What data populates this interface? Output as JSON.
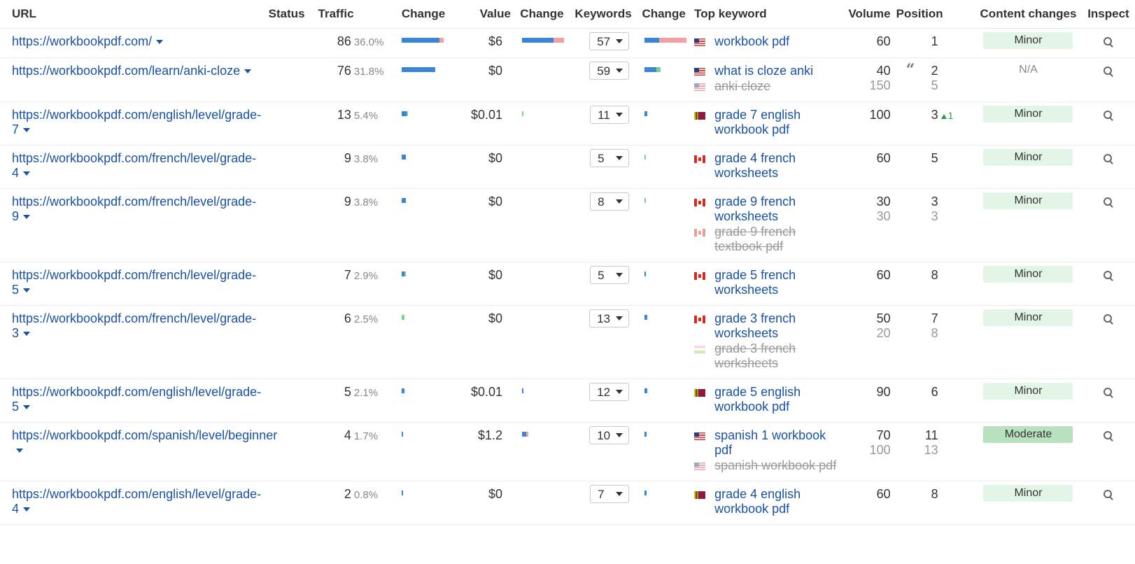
{
  "headers": {
    "url": "URL",
    "status": "Status",
    "traffic": "Traffic",
    "traffic_change": "Change",
    "value": "Value",
    "value_change": "Change",
    "keywords": "Keywords",
    "keywords_change": "Change",
    "top_keyword": "Top keyword",
    "volume": "Volume",
    "position": "Position",
    "content_changes": "Content changes",
    "inspect": "Inspect"
  },
  "colors": {
    "link": "#1a52a5",
    "bar_blue": "#3a85d6",
    "bar_pink": "#f2a0a0",
    "bar_green": "#7ccf8f",
    "badge_minor": "#e2f5e6",
    "badge_moderate": "#b8e2bf",
    "position_up": "#2c9b43"
  },
  "rows": [
    {
      "url": "https://workbookpdf.com/",
      "traffic": "86",
      "traffic_pct": "36.0%",
      "traffic_bar": [
        {
          "c": "blue",
          "f": 0.9
        },
        {
          "c": "pink",
          "f": 0.1
        }
      ],
      "value": "$6",
      "value_bar": [
        {
          "c": "blue",
          "f": 0.75
        },
        {
          "c": "pink",
          "f": 0.25
        }
      ],
      "keywords": "57",
      "kw_bar": [
        {
          "c": "blue",
          "f": 0.35
        },
        {
          "c": "pink",
          "f": 0.65
        }
      ],
      "keywords_list": [
        {
          "flag": "us",
          "text": "workbook pdf",
          "muted": false
        }
      ],
      "volumes": [
        "60"
      ],
      "positions": [
        "1"
      ],
      "pos_up": "",
      "quote": false,
      "content_change": "Minor",
      "badge": "minor"
    },
    {
      "url": "https://workbookpdf.com/learn/anki-cloze",
      "traffic": "76",
      "traffic_pct": "31.8%",
      "traffic_bar": [
        {
          "c": "blue",
          "f": 0.8
        }
      ],
      "value": "$0",
      "value_bar": [],
      "keywords": "59",
      "kw_bar": [
        {
          "c": "blue",
          "f": 0.28
        },
        {
          "c": "green",
          "f": 0.1
        }
      ],
      "keywords_list": [
        {
          "flag": "us",
          "text": "what is cloze anki",
          "muted": false
        },
        {
          "flag": "us",
          "text": "anki cloze",
          "muted": true
        }
      ],
      "volumes": [
        "40",
        "150"
      ],
      "positions": [
        "2",
        "5"
      ],
      "pos_up": "",
      "quote": true,
      "content_change": "N/A",
      "badge": "na"
    },
    {
      "url": "https://workbookpdf.com/english/level/grade-7",
      "traffic": "13",
      "traffic_pct": "5.4%",
      "traffic_bar": [
        {
          "c": "blue",
          "f": 0.12
        },
        {
          "c": "green",
          "f": 0.03
        }
      ],
      "value": "$0.01",
      "value_bar": [
        {
          "c": "green",
          "f": 0.02
        }
      ],
      "keywords": "11",
      "kw_bar": [
        {
          "c": "blue",
          "f": 0.06
        }
      ],
      "keywords_list": [
        {
          "flag": "lk",
          "text": "grade 7 english workbook pdf",
          "muted": false
        }
      ],
      "volumes": [
        "100"
      ],
      "positions": [
        "3"
      ],
      "pos_up": "1",
      "quote": false,
      "content_change": "Minor",
      "badge": "minor"
    },
    {
      "url": "https://workbookpdf.com/french/level/grade-4",
      "traffic": "9",
      "traffic_pct": "3.8%",
      "traffic_bar": [
        {
          "c": "blue",
          "f": 0.1
        }
      ],
      "value": "$0",
      "value_bar": [],
      "keywords": "5",
      "kw_bar": [
        {
          "c": "green",
          "f": 0.04
        }
      ],
      "keywords_list": [
        {
          "flag": "ca",
          "text": "grade 4 french worksheets",
          "muted": false
        }
      ],
      "volumes": [
        "60"
      ],
      "positions": [
        "5"
      ],
      "pos_up": "",
      "quote": false,
      "content_change": "Minor",
      "badge": "minor"
    },
    {
      "url": "https://workbookpdf.com/french/level/grade-9",
      "traffic": "9",
      "traffic_pct": "3.8%",
      "traffic_bar": [
        {
          "c": "blue",
          "f": 0.1
        }
      ],
      "value": "$0",
      "value_bar": [],
      "keywords": "8",
      "kw_bar": [
        {
          "c": "green",
          "f": 0.04
        }
      ],
      "keywords_list": [
        {
          "flag": "ca",
          "text": "grade 9 french worksheets",
          "muted": false
        },
        {
          "flag": "ca",
          "text": "grade 9 french textbook pdf",
          "muted": true
        }
      ],
      "volumes": [
        "30",
        "30"
      ],
      "positions": [
        "3",
        "3"
      ],
      "pos_up": "",
      "quote": false,
      "content_change": "Minor",
      "badge": "minor"
    },
    {
      "url": "https://workbookpdf.com/french/level/grade-5",
      "traffic": "7",
      "traffic_pct": "2.9%",
      "traffic_bar": [
        {
          "c": "blue",
          "f": 0.06
        },
        {
          "c": "green",
          "f": 0.02
        }
      ],
      "value": "$0",
      "value_bar": [],
      "keywords": "5",
      "kw_bar": [
        {
          "c": "blue",
          "f": 0.03
        }
      ],
      "keywords_list": [
        {
          "flag": "ca",
          "text": "grade 5 french worksheets",
          "muted": false
        }
      ],
      "volumes": [
        "60"
      ],
      "positions": [
        "8"
      ],
      "pos_up": "",
      "quote": false,
      "content_change": "Minor",
      "badge": "minor"
    },
    {
      "url": "https://workbookpdf.com/french/level/grade-3",
      "traffic": "6",
      "traffic_pct": "2.5%",
      "traffic_bar": [
        {
          "c": "green",
          "f": 0.06
        }
      ],
      "value": "$0",
      "value_bar": [],
      "keywords": "13",
      "kw_bar": [
        {
          "c": "blue",
          "f": 0.07
        }
      ],
      "keywords_list": [
        {
          "flag": "ca",
          "text": "grade 3 french worksheets",
          "muted": false
        },
        {
          "flag": "tri",
          "text": "grade 3 french worksheets",
          "muted": true
        }
      ],
      "volumes": [
        "50",
        "20"
      ],
      "positions": [
        "7",
        "8"
      ],
      "pos_up": "",
      "quote": false,
      "content_change": "Minor",
      "badge": "minor"
    },
    {
      "url": "https://workbookpdf.com/english/level/grade-5",
      "traffic": "5",
      "traffic_pct": "2.1%",
      "traffic_bar": [
        {
          "c": "blue",
          "f": 0.06
        }
      ],
      "value": "$0.01",
      "value_bar": [
        {
          "c": "blue",
          "f": 0.02
        }
      ],
      "keywords": "12",
      "kw_bar": [
        {
          "c": "blue",
          "f": 0.06
        }
      ],
      "keywords_list": [
        {
          "flag": "lk",
          "text": "grade 5 english workbook pdf",
          "muted": false
        }
      ],
      "volumes": [
        "90"
      ],
      "positions": [
        "6"
      ],
      "pos_up": "",
      "quote": false,
      "content_change": "Minor",
      "badge": "minor"
    },
    {
      "url": "https://workbookpdf.com/spanish/level/beginner",
      "traffic": "4",
      "traffic_pct": "1.7%",
      "traffic_bar": [
        {
          "c": "blue",
          "f": 0.04
        }
      ],
      "value": "$1.2",
      "value_bar": [
        {
          "c": "blue",
          "f": 0.1
        },
        {
          "c": "pink",
          "f": 0.05
        }
      ],
      "keywords": "10",
      "kw_bar": [
        {
          "c": "blue",
          "f": 0.05
        }
      ],
      "keywords_list": [
        {
          "flag": "us",
          "text": "spanish 1 workbook pdf",
          "muted": false
        },
        {
          "flag": "us",
          "text": "spanish workbook pdf",
          "muted": true
        }
      ],
      "volumes": [
        "70",
        "100"
      ],
      "positions": [
        "11",
        "13"
      ],
      "pos_up": "",
      "quote": false,
      "content_change": "Moderate",
      "badge": "moderate"
    },
    {
      "url": "https://workbookpdf.com/english/level/grade-4",
      "traffic": "2",
      "traffic_pct": "0.8%",
      "traffic_bar": [
        {
          "c": "blue",
          "f": 0.03
        }
      ],
      "value": "$0",
      "value_bar": [],
      "keywords": "7",
      "kw_bar": [
        {
          "c": "blue",
          "f": 0.05
        }
      ],
      "keywords_list": [
        {
          "flag": "lk",
          "text": "grade 4 english workbook pdf",
          "muted": false
        }
      ],
      "volumes": [
        "60"
      ],
      "positions": [
        "8"
      ],
      "pos_up": "",
      "quote": false,
      "content_change": "Minor",
      "badge": "minor"
    }
  ]
}
